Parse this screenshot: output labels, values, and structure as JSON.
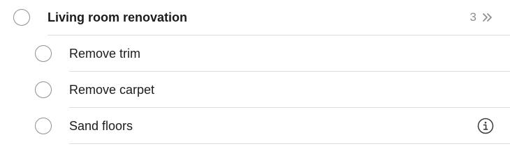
{
  "parent": {
    "title": "Living room renovation",
    "subtask_count": "3",
    "expand_icon": "double-chevron-right-icon"
  },
  "subtasks": [
    {
      "title": "Remove trim",
      "completed": false
    },
    {
      "title": "Remove carpet",
      "completed": false
    },
    {
      "title": "Sand floors",
      "completed": false,
      "icon": "info-icon"
    }
  ],
  "colors": {
    "text": "#1c1c1e",
    "secondary": "#8e8e93",
    "divider": "#dcdcde"
  }
}
